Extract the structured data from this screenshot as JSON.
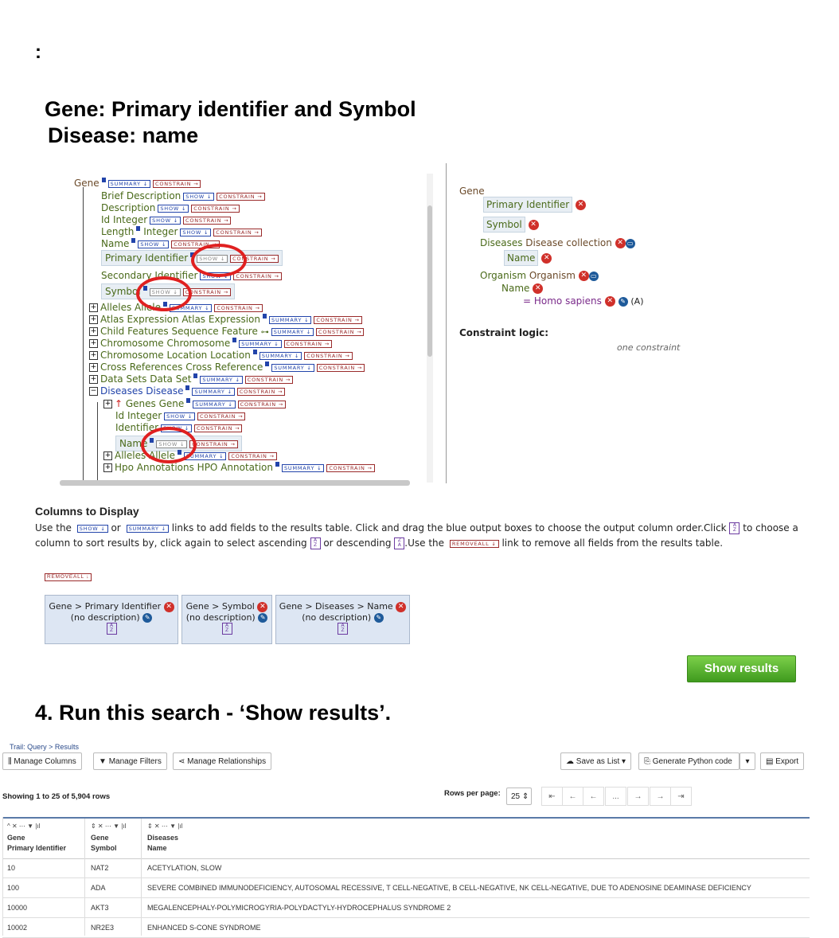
{
  "headings": {
    "colon": ":",
    "line1": "Gene:  Primary identifier and Symbol",
    "line2": "Disease: name",
    "step4": "4. Run this search - ‘Show results’."
  },
  "tags": {
    "summary": "SUMMARY ↓",
    "constrain": "CONSTRAIN →",
    "show": "SHOW ↓",
    "removeall": "REMOVEALL ↓"
  },
  "tree": {
    "root": "Gene",
    "nodes": [
      {
        "label": "Brief Description",
        "kind": "attr"
      },
      {
        "label": "Description",
        "kind": "attr"
      },
      {
        "label": "Id Integer",
        "kind": "attr"
      },
      {
        "label": "Length",
        "label2": "Integer",
        "kind": "attr"
      },
      {
        "label": "Name",
        "kind": "attr"
      },
      {
        "label": "Primary Identifier",
        "kind": "selected"
      },
      {
        "label": "Secondary Identifier",
        "kind": "attr"
      },
      {
        "label": "Symbol",
        "kind": "selected"
      },
      {
        "label": "Alleles Allele",
        "kind": "ref"
      },
      {
        "label": "Atlas Expression Atlas Expression",
        "kind": "ref"
      },
      {
        "label": "Child Features Sequence Feature",
        "kind": "ref"
      },
      {
        "label": "Chromosome Chromosome",
        "kind": "ref"
      },
      {
        "label": "Chromosome Location Location",
        "kind": "ref"
      },
      {
        "label": "Cross References Cross Reference",
        "kind": "ref"
      },
      {
        "label": "Data Sets Data Set",
        "kind": "ref"
      },
      {
        "label": "Diseases",
        "label2": "Disease",
        "kind": "open"
      },
      {
        "label": "Genes Gene",
        "kind": "ref2"
      },
      {
        "label": "Id Integer",
        "kind": "attr2"
      },
      {
        "label": "Identifier",
        "kind": "attr2"
      },
      {
        "label": "Name",
        "kind": "selected2"
      },
      {
        "label": "Alleles Allele",
        "kind": "ref2"
      },
      {
        "label": "Hpo Annotations HPO Annotation",
        "kind": "ref2"
      }
    ]
  },
  "query": {
    "root": "Gene",
    "primary": "Primary Identifier",
    "symbol": "Symbol",
    "diseases": "Diseases",
    "diseases_type": "Disease  collection",
    "name": "Name",
    "organism": "Organism",
    "organism_type": "Organism",
    "org_name": "Name",
    "constraint": "= Homo sapiens",
    "code": "(A)",
    "logic_label": "Constraint logic:",
    "logic_value": "one constraint"
  },
  "columns": {
    "title": "Columns to Display",
    "text1": "Use the",
    "text2": "or",
    "text3": "links to add fields to the results table. Click and drag the blue output boxes to choose the output column order.Click",
    "text4": "to choose a column to sort results by, click again to select ascending",
    "text5": "or descending",
    "text6": ".Use the",
    "text7": "link to remove all fields from the results table.",
    "boxes": [
      {
        "path": "Gene > Primary Identifier",
        "desc": "(no description)"
      },
      {
        "path": "Gene > Symbol",
        "desc": "(no description)"
      },
      {
        "path": "Gene > Diseases > Name",
        "desc": "(no description)"
      }
    ],
    "show_results": "Show results"
  },
  "results": {
    "trail": "Trail: Query > Results",
    "manage_columns": "Manage Columns",
    "manage_filters": "Manage Filters",
    "manage_relationships": "Manage Relationships",
    "save_as_list": "Save as List",
    "generate_code": "Generate Python code",
    "export": "Export",
    "showing": "Showing 1 to 25 of 5,904 rows",
    "rows_per_page_label": "Rows per page:",
    "rows_per_page": "25",
    "pager": [
      "⇤",
      "←",
      "←",
      "...",
      "→",
      "→",
      "⇥"
    ],
    "headers": [
      {
        "l1": "Gene",
        "l2": "Primary Identifier"
      },
      {
        "l1": "Gene",
        "l2": "Symbol"
      },
      {
        "l1": "Diseases",
        "l2": "Name"
      }
    ],
    "rows": [
      [
        "10",
        "NAT2",
        "ACETYLATION, SLOW"
      ],
      [
        "100",
        "ADA",
        "SEVERE COMBINED IMMUNODEFICIENCY, AUTOSOMAL RECESSIVE, T CELL-NEGATIVE, B CELL-NEGATIVE, NK CELL-NEGATIVE, DUE TO ADENOSINE DEAMINASE DEFICIENCY"
      ],
      [
        "10000",
        "AKT3",
        "MEGALENCEPHALY-POLYMICROGYRIA-POLYDACTYLY-HYDROCEPHALUS SYNDROME 2"
      ],
      [
        "10002",
        "NR2E3",
        "ENHANCED S-CONE SYNDROME"
      ]
    ]
  }
}
